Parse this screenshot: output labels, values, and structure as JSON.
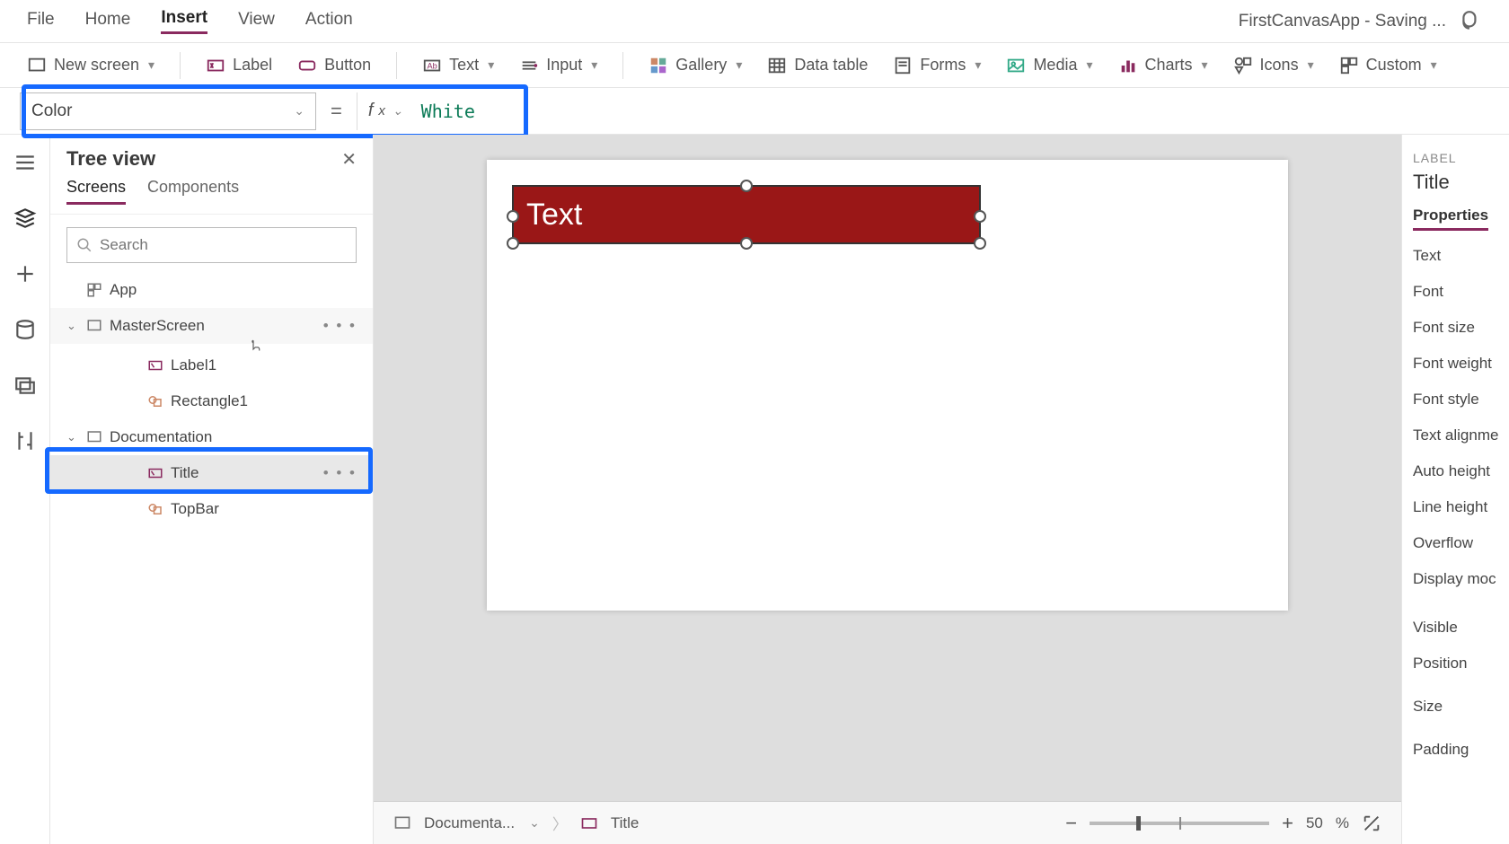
{
  "menu": {
    "file": "File",
    "home": "Home",
    "insert": "Insert",
    "view": "View",
    "action": "Action",
    "app_title": "FirstCanvasApp - Saving ..."
  },
  "ribbon": {
    "new_screen": "New screen",
    "label": "Label",
    "button": "Button",
    "text": "Text",
    "input": "Input",
    "gallery": "Gallery",
    "data_table": "Data table",
    "forms": "Forms",
    "media": "Media",
    "charts": "Charts",
    "icons": "Icons",
    "custom": "Custom"
  },
  "formula_bar": {
    "property": "Color",
    "value": "White"
  },
  "tree": {
    "title": "Tree view",
    "tabs": {
      "screens": "Screens",
      "components": "Components"
    },
    "search_placeholder": "Search",
    "app": "App",
    "master_screen": "MasterScreen",
    "label1": "Label1",
    "rectangle1": "Rectangle1",
    "documentation": "Documentation",
    "title_node": "Title",
    "topbar": "TopBar"
  },
  "canvas": {
    "label_text": "Text"
  },
  "breadcrumb": {
    "screen": "Documenta...",
    "control": "Title",
    "zoom_value": "50",
    "zoom_suffix": "%"
  },
  "props": {
    "type": "LABEL",
    "name": "Title",
    "tab": "Properties",
    "rows": [
      "Text",
      "Font",
      "Font size",
      "Font weight",
      "Font style",
      "Text alignme",
      "Auto height",
      "Line height",
      "Overflow",
      "Display moc",
      "Visible",
      "Position",
      "Size",
      "Padding"
    ]
  }
}
